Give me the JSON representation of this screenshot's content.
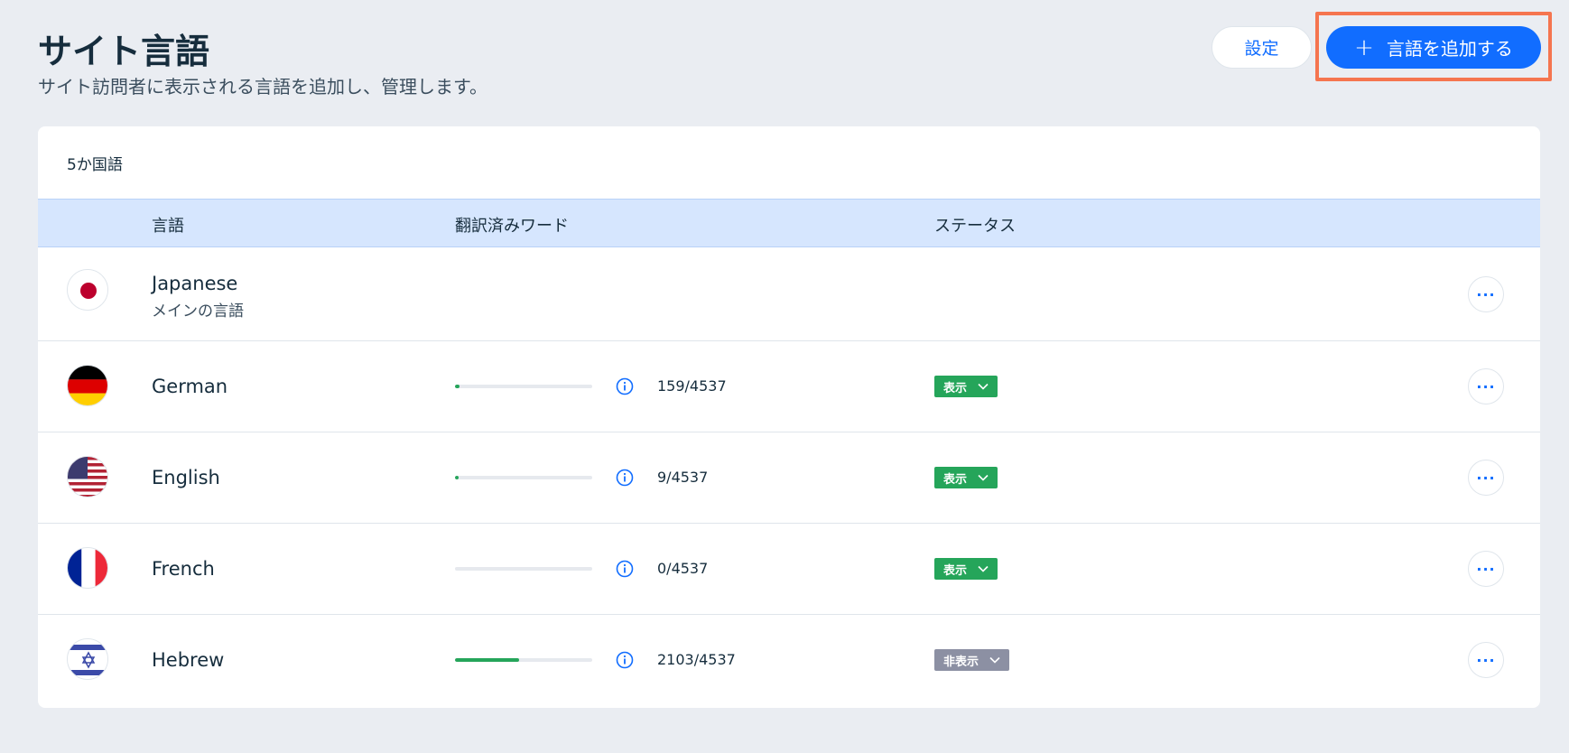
{
  "page": {
    "title": "サイト言語",
    "subtitle": "サイト訪問者に表示される言語を追加し、管理します。"
  },
  "actions": {
    "settings_label": "設定",
    "add_language_label": "言語を追加する",
    "add_icon": "plus-icon"
  },
  "table": {
    "count_label": "5か国語",
    "columns": {
      "language": "言語",
      "translated_words": "翻訳済みワード",
      "status": "ステータス"
    },
    "rows": [
      {
        "name": "Japanese",
        "sub": "メインの言語",
        "flag": "japan-flag-icon",
        "more": "···"
      },
      {
        "name": "German",
        "flag": "germany-flag-icon",
        "progress": 0.035,
        "count": "159/4537",
        "status": "表示",
        "status_type": "visible",
        "more": "···"
      },
      {
        "name": "English",
        "flag": "usa-flag-icon",
        "progress": 0.002,
        "count": "9/4537",
        "status": "表示",
        "status_type": "visible",
        "more": "···"
      },
      {
        "name": "French",
        "flag": "france-flag-icon",
        "progress": 0,
        "count": "0/4537",
        "status": "表示",
        "status_type": "visible",
        "more": "···"
      },
      {
        "name": "Hebrew",
        "flag": "israel-flag-icon",
        "progress": 0.464,
        "count": "2103/4537",
        "status": "非表示",
        "status_type": "hidden",
        "more": "···"
      }
    ]
  },
  "colors": {
    "accent": "#116dff",
    "highlight": "#f5754f",
    "status_visible": "#25a55a",
    "status_hidden": "#8c90a3",
    "header_bg": "#d6e6fe"
  }
}
